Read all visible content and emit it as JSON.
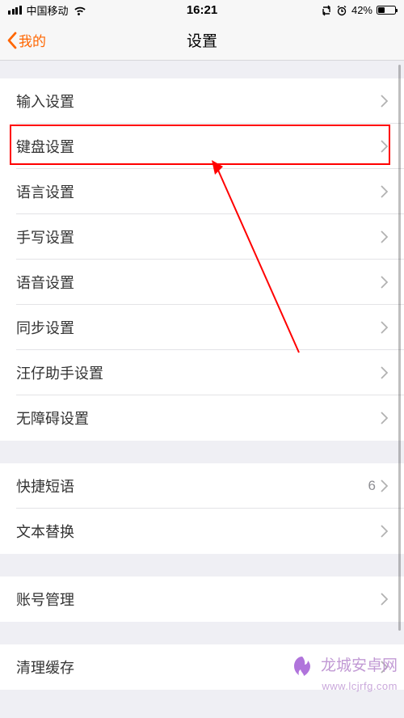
{
  "statusBar": {
    "carrier": "中国移动",
    "time": "16:21",
    "batteryPct": "42%"
  },
  "nav": {
    "back": "我的",
    "title": "设置"
  },
  "groups": [
    {
      "rows": [
        {
          "label": "输入设置"
        },
        {
          "label": "键盘设置",
          "highlighted": true
        },
        {
          "label": "语言设置"
        },
        {
          "label": "手写设置"
        },
        {
          "label": "语音设置"
        },
        {
          "label": "同步设置"
        },
        {
          "label": "汪仔助手设置"
        },
        {
          "label": "无障碍设置"
        }
      ]
    },
    {
      "rows": [
        {
          "label": "快捷短语",
          "detail": "6"
        },
        {
          "label": "文本替换"
        }
      ]
    },
    {
      "rows": [
        {
          "label": "账号管理"
        }
      ]
    },
    {
      "rows": [
        {
          "label": "清理缓存"
        }
      ]
    }
  ],
  "watermark": {
    "title": "龙城安卓网",
    "sub": "www.lcjrfg.com"
  }
}
